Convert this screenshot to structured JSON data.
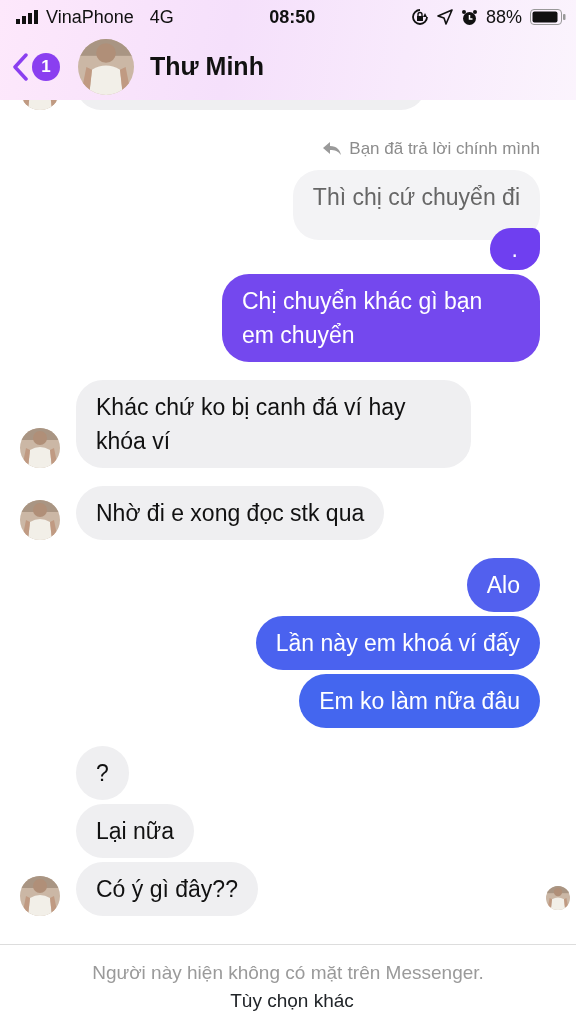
{
  "status_bar": {
    "carrier": "VinaPhone",
    "network": "4G",
    "time": "08:50",
    "battery": "88%"
  },
  "header": {
    "unread_count": "1",
    "name": "Thư Minh"
  },
  "messages": [
    {
      "kind": "cut-off",
      "avatar": true
    },
    {
      "kind": "reply-note",
      "text": "Bạn đã trả lời chính mình"
    },
    {
      "kind": "quoted",
      "text": "Thì chị cứ chuyển đi"
    },
    {
      "kind": "sent",
      "text": ".",
      "color": "#6f3ff0"
    },
    {
      "kind": "sent",
      "text": "Chị chuyển khác gì bạn em chuyển",
      "color": "#7448ee"
    },
    {
      "kind": "received",
      "text": "Khác chứ ko bị canh đá ví hay khóa ví",
      "avatar": true,
      "seen": false
    },
    {
      "kind": "received",
      "text": "Nhờ đi e xong đọc stk qua",
      "avatar": true,
      "seen": false
    },
    {
      "kind": "sent",
      "text": "Alo",
      "color": "#5260ee"
    },
    {
      "kind": "sent",
      "text": "Lần này em khoá ví đấy",
      "color": "#4a62ef"
    },
    {
      "kind": "sent",
      "text": "Em ko làm nữa đâu",
      "color": "#4466ef"
    },
    {
      "kind": "received",
      "text": "?",
      "avatar": false,
      "seen": false
    },
    {
      "kind": "received",
      "text": "Lại nữa",
      "avatar": false,
      "seen": false
    },
    {
      "kind": "received",
      "text": "Có ý gì đây??",
      "avatar": true,
      "seen": true
    }
  ],
  "footer": {
    "notice": "Người này hiện không có mặt trên Messenger.",
    "link": "Tùy chọn khác"
  }
}
